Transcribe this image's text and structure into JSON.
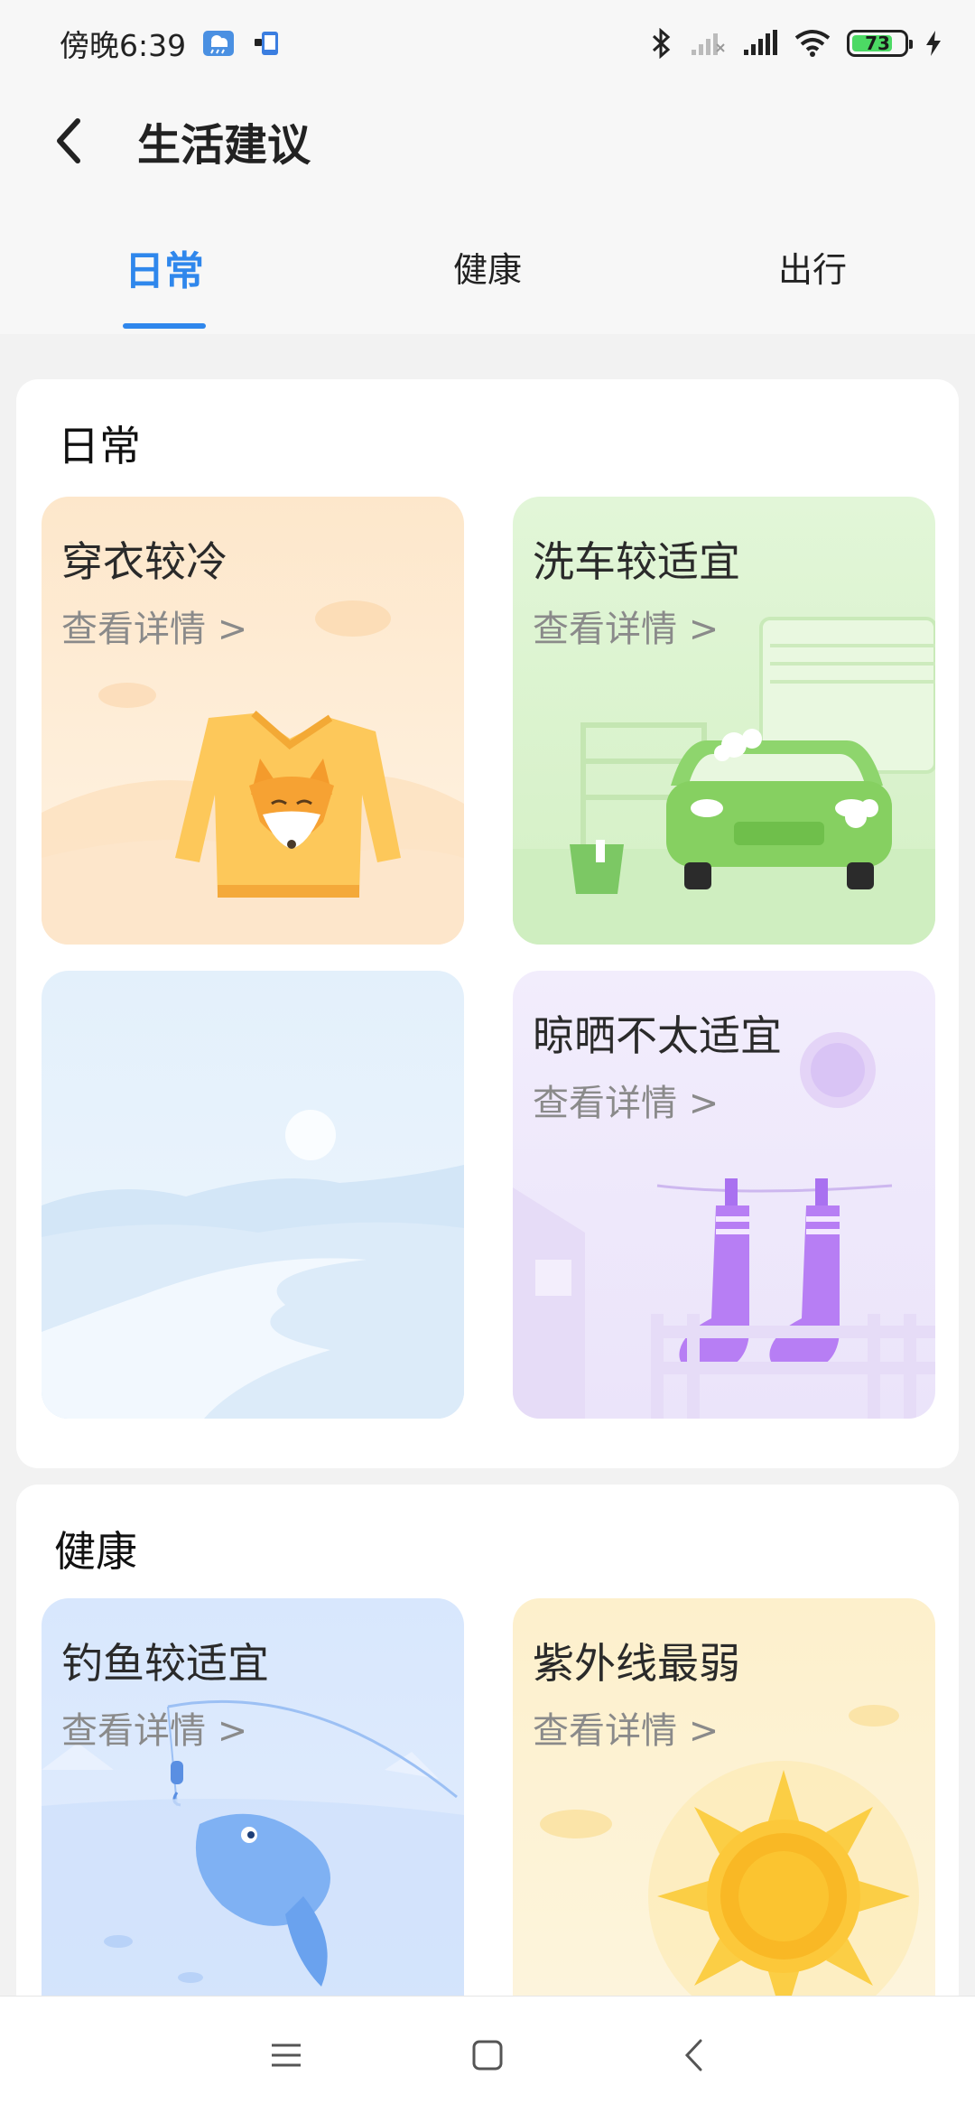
{
  "status_bar": {
    "time": "傍晚6:39",
    "battery": "73"
  },
  "header": {
    "title": "生活建议"
  },
  "tabs": [
    {
      "label": "日常",
      "active": true
    },
    {
      "label": "健康",
      "active": false
    },
    {
      "label": "出行",
      "active": false
    }
  ],
  "sections": [
    {
      "title": "日常",
      "tiles": [
        {
          "title": "穿衣较冷",
          "link": "查看详情 >",
          "icon": "sweater-fox-illustration"
        },
        {
          "title": "洗车较适宜",
          "link": "查看详情 >",
          "icon": "green-car-illustration"
        },
        {
          "title": "",
          "link": "",
          "icon": "river-landscape-illustration"
        },
        {
          "title": "晾晒不太适宜",
          "link": "查看详情 >",
          "icon": "socks-clothesline-illustration"
        }
      ]
    },
    {
      "title": "健康",
      "tiles": [
        {
          "title": "钓鱼较适宜",
          "link": "查看详情 >",
          "icon": "fish-illustration"
        },
        {
          "title": "紫外线最弱",
          "link": "查看详情 >",
          "icon": "sun-illustration"
        }
      ]
    }
  ],
  "navbar": {
    "icons": [
      "menu-icon",
      "home-square-icon",
      "back-chevron-icon"
    ]
  },
  "colors": {
    "accent": "#2f87ec",
    "tile_clothes": "#fde9cf",
    "tile_carwash": "#dff5d4",
    "tile_landscape": "#e3f0fb",
    "tile_drying": "#f0ebfb",
    "tile_fishing": "#d9e8fd",
    "tile_uv": "#fdf1cf"
  }
}
